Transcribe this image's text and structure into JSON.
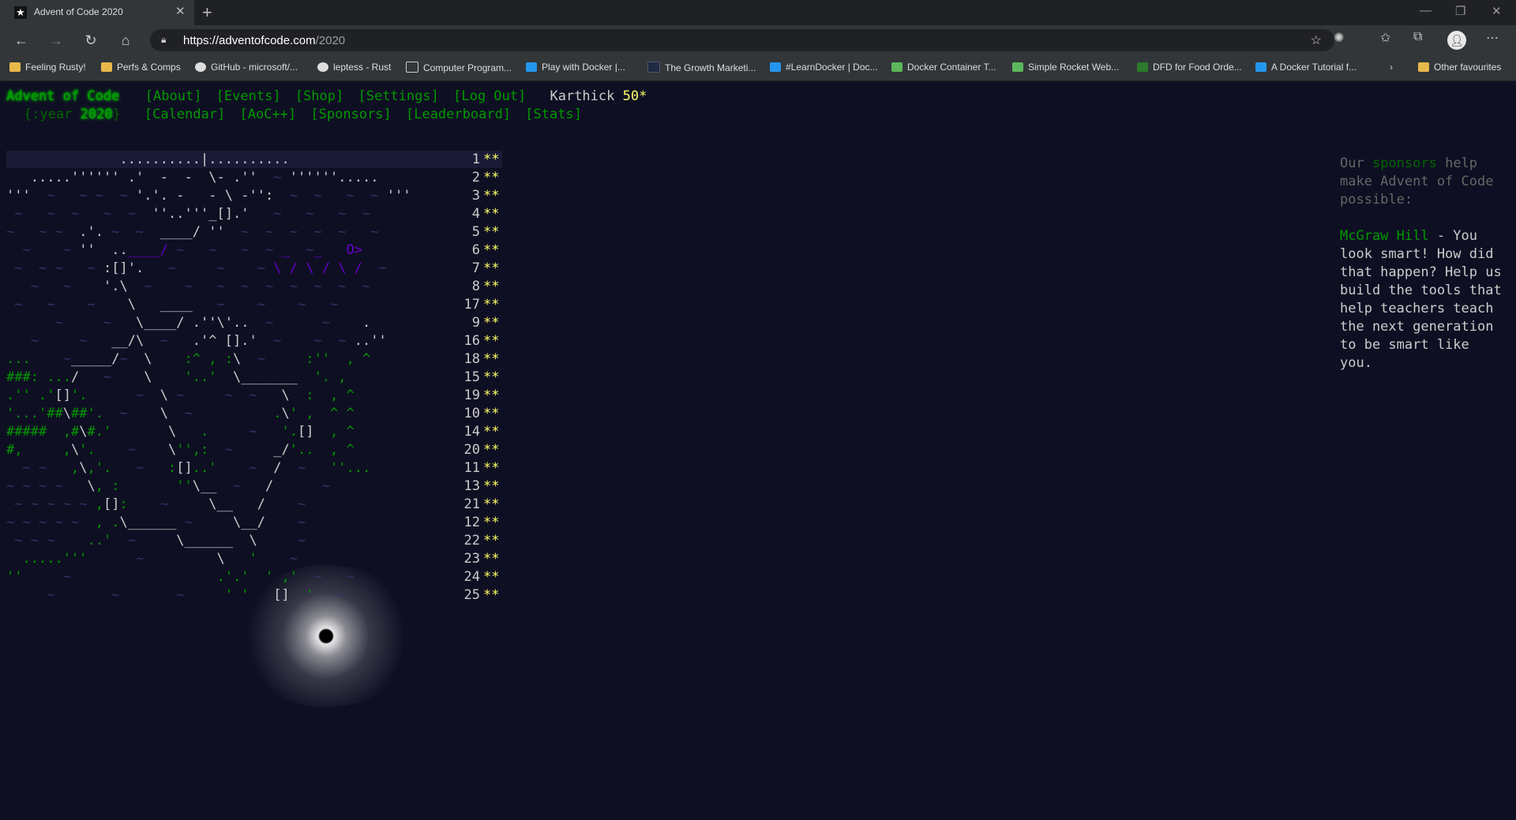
{
  "browser": {
    "tab_title": "Advent of Code 2020",
    "url_host": "https://adventofcode.com",
    "url_path": "/2020",
    "bookmarks": [
      "Feeling Rusty!",
      "Perfs & Comps",
      "GitHub - microsoft/...",
      "leptess - Rust",
      "Computer Program...",
      "Play with Docker |...",
      "The Growth Marketi...",
      "#LearnDocker | Doc...",
      "Docker Container T...",
      "Simple Rocket Web...",
      "DFD for Food Orde...",
      "A Docker Tutorial f...",
      "Other favourites"
    ]
  },
  "header": {
    "title": "Advent of Code",
    "nav": [
      "[About]",
      "[Events]",
      "[Shop]",
      "[Settings]",
      "[Log Out]"
    ],
    "user": "Karthick",
    "star_count": "50*",
    "year_prefix": "{:year ",
    "year": "2020",
    "year_suffix": "}",
    "nav2": [
      "[Calendar]",
      "[AoC++]",
      "[Sponsors]",
      "[Leaderboard]",
      "[Stats]"
    ]
  },
  "calendar": {
    "rows": [
      {
        "day": "1",
        "stars": "**"
      },
      {
        "day": "2",
        "stars": "**"
      },
      {
        "day": "3",
        "stars": "**"
      },
      {
        "day": "4",
        "stars": "**"
      },
      {
        "day": "5",
        "stars": "**"
      },
      {
        "day": "6",
        "stars": "**"
      },
      {
        "day": "7",
        "stars": "**"
      },
      {
        "day": "8",
        "stars": "**"
      },
      {
        "day": "17",
        "stars": "**"
      },
      {
        "day": "9",
        "stars": "**"
      },
      {
        "day": "16",
        "stars": "**"
      },
      {
        "day": "18",
        "stars": "**"
      },
      {
        "day": "15",
        "stars": "**"
      },
      {
        "day": "19",
        "stars": "**"
      },
      {
        "day": "10",
        "stars": "**"
      },
      {
        "day": "14",
        "stars": "**"
      },
      {
        "day": "20",
        "stars": "**"
      },
      {
        "day": "11",
        "stars": "**"
      },
      {
        "day": "13",
        "stars": "**"
      },
      {
        "day": "21",
        "stars": "**"
      },
      {
        "day": "12",
        "stars": "**"
      },
      {
        "day": "22",
        "stars": "**"
      },
      {
        "day": "23",
        "stars": "**"
      },
      {
        "day": "24",
        "stars": "**"
      },
      {
        "day": "25",
        "stars": "**"
      }
    ],
    "art": [
      "              ..........|..........",
      "   .....'''''' .'  -  -  \\- .''  ~ ''''''.....",
      "'''  ~   ~ ~  ~ '.'. -   - \\ -'':  ~  ~   ~  ~ '''",
      " ~   ~  ~   ~  ~  ''..'''_[].'   ~   ~   ~  ~",
      "~   ~ ~  .'. ~  ~  ____/ ''  ~  ~  ~  ~  ~   ~",
      "  ~    ~ ''  ..____/ ~   ~   ~  ~ _  ~_   O>",
      " ~  ~ ~   ~ :[]'.   ~     ~    ~ \\ / \\ / \\ /  ~",
      "   ~   ~    '.\\  ~    ~   ~  ~  ~  ~  ~  ~  ~",
      " ~   ~    ~    \\   ____   ~    ~    ~   ~",
      "      ~     ~   \\____/ .''\\'..  ~      ~    .",
      "   ~     ~   __/\\  ~   .'^ [].'  ~    ~  ~ ..''",
      "...    ~_____/~  \\    :^ , :\\  ~     :''  , ^",
      "###: .../   ~    \\    '..'  \\_______  '. ,",
      ".'' .'[]'.      ~  \\ ~     ~  ~   \\  :  , ^",
      "'...'##\\##'.  ~    \\  ~          .\\' ,  ^ ^",
      "#####  ,#\\#.'       \\   .     ~   '.[]  , ^",
      "#,     ,\\'.    ~    \\'',:  ~     _/'..  , ^",
      "  ~ ~   ,\\,'.   ~   :[]..'    ~  /  ~   ''...",
      "~ ~ ~ ~   \\, :       ''\\__  ~   /      ~",
      " ~ ~ ~ ~ ~ ,[]:    ~     \\__   /    ~",
      "~ ~ ~ ~ ~  , .\\______ ~     \\__/    ~",
      " ~ ~ ~    ..'  ~     \\______  \\     ~",
      "  .....'''      ~         \\   '    ~",
      "''     ~                  .'.'  ' ,'  ~   ~",
      "     ~       ~       ~     ' '   []  '   ~"
    ]
  },
  "sponsor": {
    "intro_1": "Our ",
    "intro_link": "sponsors",
    "intro_2": " help make Advent of Code possible:",
    "name": "McGraw Hill",
    "text": " - You look smart! How did that happen? Help us build the tools that help teachers teach the next generation to be smart like you."
  },
  "colors": {
    "background": "#0f0f23",
    "green": "#009900",
    "bright_green": "#00cc00",
    "gold": "#ffff66",
    "text": "#cccccc"
  }
}
